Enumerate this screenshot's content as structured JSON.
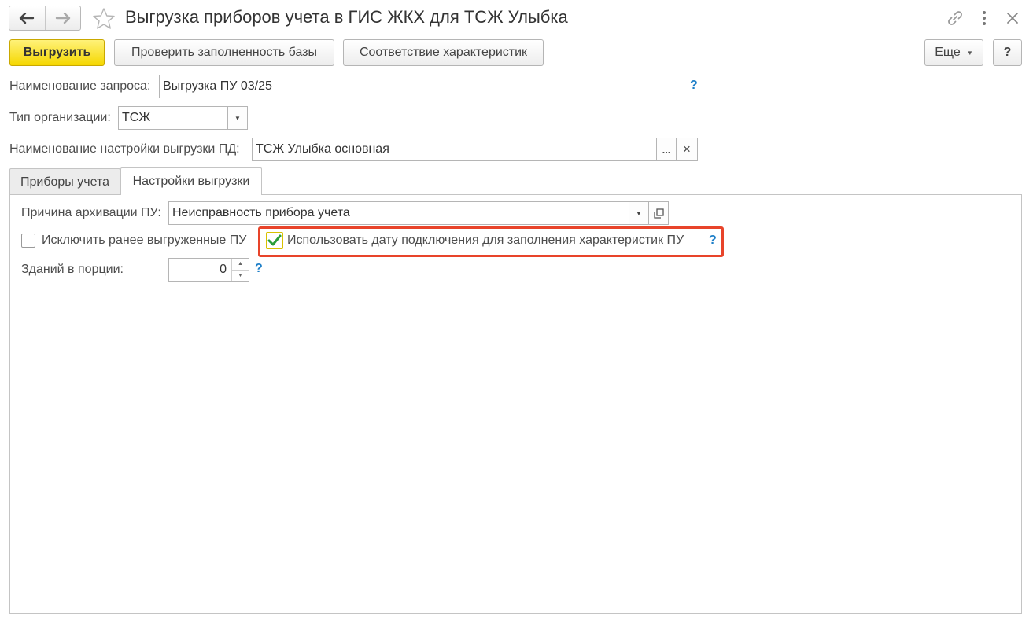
{
  "window": {
    "title": "Выгрузка приборов учета в ГИС ЖКХ для ТСЖ Улыбка"
  },
  "toolbar": {
    "upload_label": "Выгрузить",
    "check_label": "Проверить заполненность базы",
    "match_label": "Соответствие характеристик",
    "more_label": "Еще",
    "help_label": "?"
  },
  "form": {
    "request_name_label": "Наименование запроса:",
    "request_name_value": "Выгрузка ПУ 03/25",
    "org_type_label": "Тип организации:",
    "org_type_value": "ТСЖ",
    "settings_label": "Наименование настройки выгрузки ПД:",
    "settings_value": "ТСЖ Улыбка основная",
    "settings_select": "...",
    "settings_clear": "×",
    "help_mark": "?"
  },
  "tabs": [
    {
      "label": "Приборы учета",
      "active": false
    },
    {
      "label": "Настройки выгрузки",
      "active": true
    }
  ],
  "settings_tab": {
    "archive_reason_label": "Причина архивации ПУ:",
    "archive_reason_value": "Неисправность прибора учета",
    "exclude_label": "Исключить ранее выгруженные ПУ",
    "exclude_checked": false,
    "use_date_label": "Использовать дату подключения для заполнения характеристик ПУ",
    "use_date_checked": true,
    "buildings_label": "Зданий в порции:",
    "buildings_value": "0",
    "help_mark": "?"
  },
  "colors": {
    "primary_button": "#f5d700",
    "highlight_border": "#e8442a",
    "help_link": "#1e7fc8",
    "checkmark": "#2a9d3a"
  }
}
